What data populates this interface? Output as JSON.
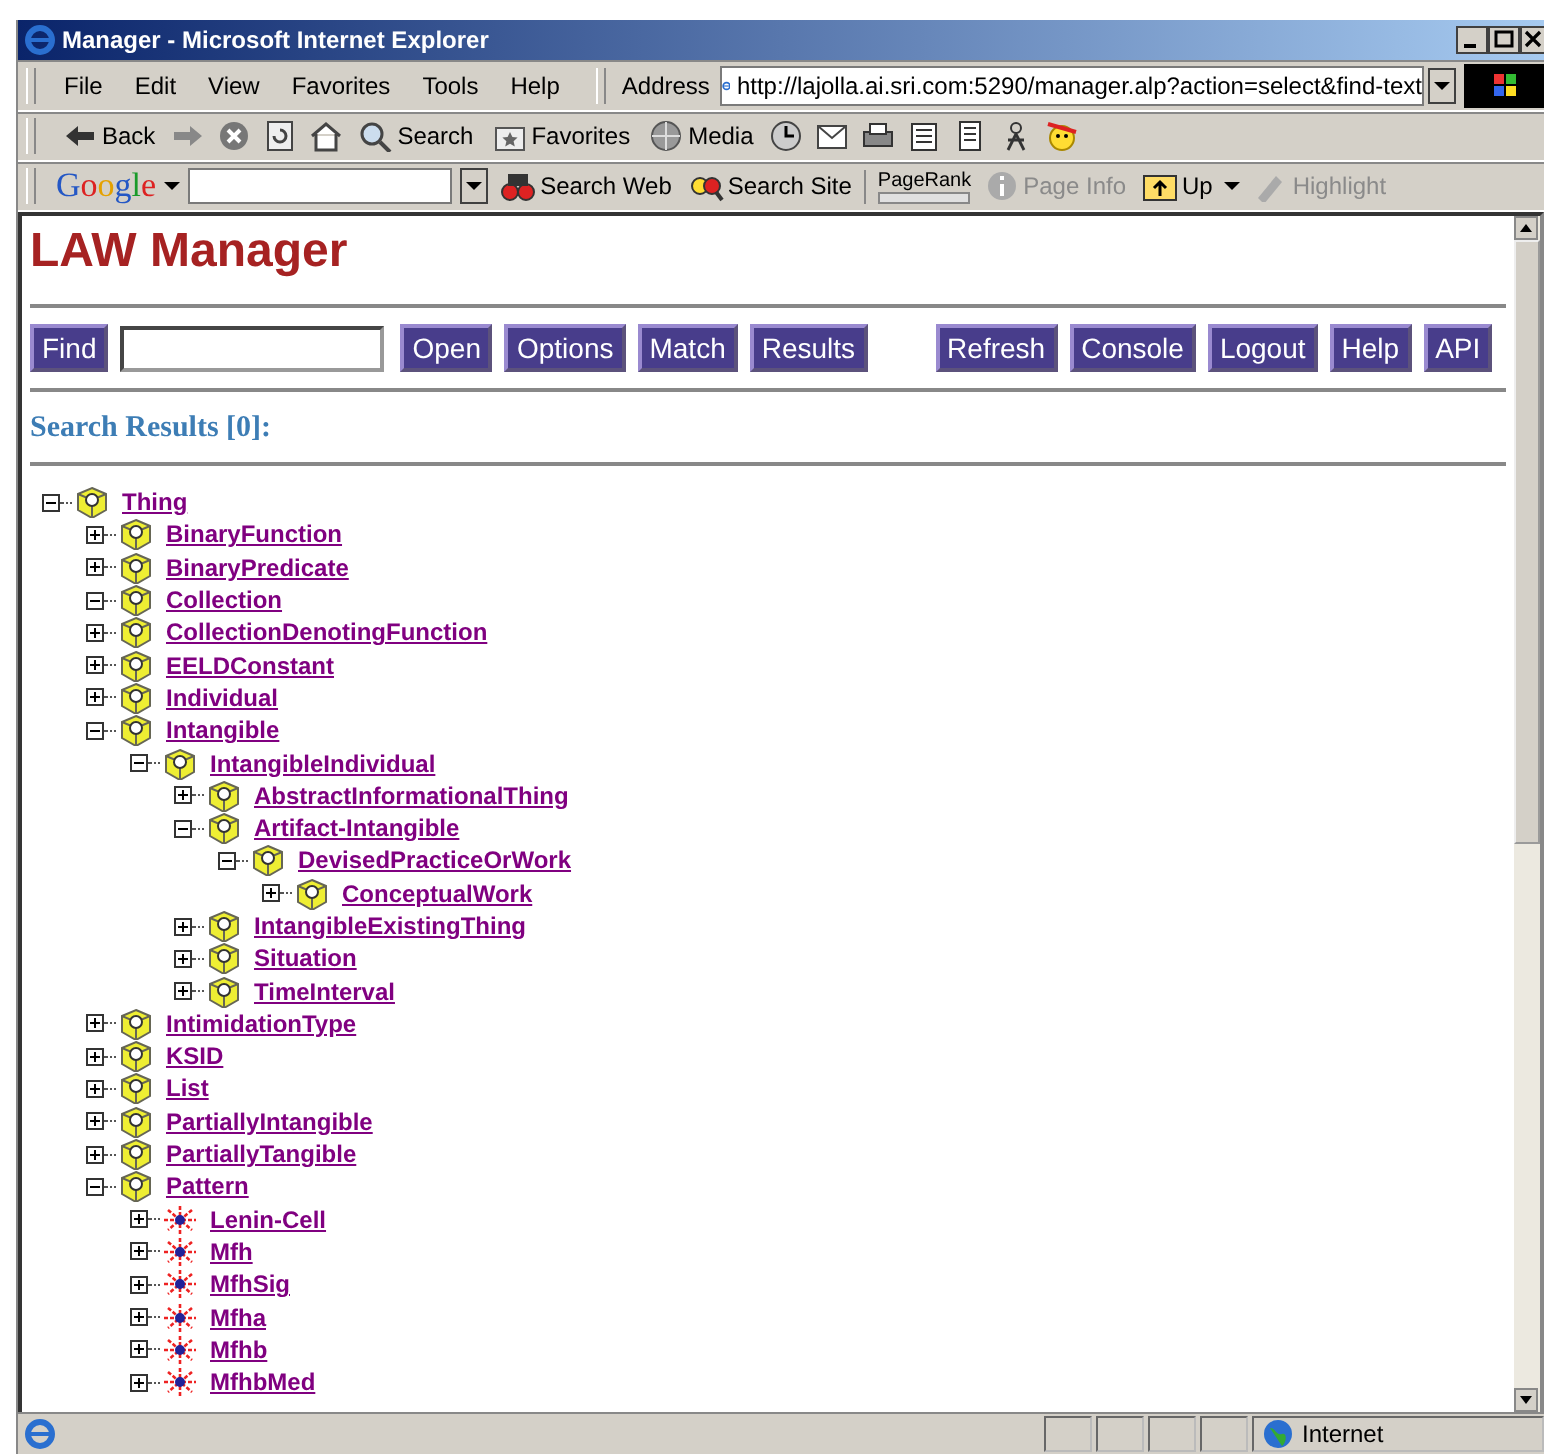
{
  "window": {
    "title": "Manager - Microsoft Internet Explorer"
  },
  "menu": [
    "File",
    "Edit",
    "View",
    "Favorites",
    "Tools",
    "Help"
  ],
  "address": {
    "label": "Address",
    "url": "http://lajolla.ai.sri.com:5290/manager.alp?action=select&find-text"
  },
  "toolbar": [
    {
      "kind": "back",
      "label": "Back"
    },
    {
      "kind": "forward"
    },
    {
      "kind": "stop"
    },
    {
      "kind": "refresh"
    },
    {
      "kind": "home"
    },
    {
      "kind": "search",
      "label": "Search"
    },
    {
      "kind": "favorites",
      "label": "Favorites"
    },
    {
      "kind": "media",
      "label": "Media"
    },
    {
      "kind": "history"
    },
    {
      "kind": "mail"
    },
    {
      "kind": "print"
    },
    {
      "kind": "edit"
    },
    {
      "kind": "discuss"
    },
    {
      "kind": "messenger"
    },
    {
      "kind": "smiley"
    }
  ],
  "google": {
    "logo": "Google",
    "search_web": "Search Web",
    "search_site": "Search Site",
    "pagerank": "PageRank",
    "page_info": "Page Info",
    "up": "Up",
    "highlight": "Highlight"
  },
  "page": {
    "heading": "LAW Manager",
    "buttons_left": [
      "Find"
    ],
    "buttons_mid": [
      "Open",
      "Options",
      "Match",
      "Results"
    ],
    "buttons_right": [
      "Refresh",
      "Console",
      "Logout",
      "Help",
      "API"
    ],
    "results_title": "Search Results [0]:"
  },
  "tree": [
    {
      "label": "Thing",
      "kind": "cube",
      "expanded": true,
      "children": [
        {
          "label": "BinaryFunction",
          "kind": "cube",
          "expanded": false
        },
        {
          "label": "BinaryPredicate",
          "kind": "cube",
          "expanded": false
        },
        {
          "label": "Collection",
          "kind": "cube",
          "expanded": true
        },
        {
          "label": "CollectionDenotingFunction",
          "kind": "cube",
          "expanded": false
        },
        {
          "label": "EELDConstant",
          "kind": "cube",
          "expanded": false
        },
        {
          "label": "Individual",
          "kind": "cube",
          "expanded": false
        },
        {
          "label": "Intangible",
          "kind": "cube",
          "expanded": true,
          "children": [
            {
              "label": "IntangibleIndividual",
              "kind": "cube",
              "expanded": true,
              "children": [
                {
                  "label": "AbstractInformationalThing",
                  "kind": "cube",
                  "expanded": false
                },
                {
                  "label": "Artifact-Intangible",
                  "kind": "cube",
                  "expanded": true,
                  "children": [
                    {
                      "label": "DevisedPracticeOrWork",
                      "kind": "cube",
                      "expanded": true,
                      "children": [
                        {
                          "label": "ConceptualWork",
                          "kind": "cube",
                          "expanded": false
                        }
                      ]
                    }
                  ]
                },
                {
                  "label": "IntangibleExistingThing",
                  "kind": "cube",
                  "expanded": false
                },
                {
                  "label": "Situation",
                  "kind": "cube",
                  "expanded": false
                },
                {
                  "label": "TimeInterval",
                  "kind": "cube",
                  "expanded": false
                }
              ]
            }
          ]
        },
        {
          "label": "IntimidationType",
          "kind": "cube",
          "expanded": false
        },
        {
          "label": "KSID",
          "kind": "cube",
          "expanded": false
        },
        {
          "label": "List",
          "kind": "cube",
          "expanded": false
        },
        {
          "label": "PartiallyIntangible",
          "kind": "cube",
          "expanded": false
        },
        {
          "label": "PartiallyTangible",
          "kind": "cube",
          "expanded": false
        },
        {
          "label": "Pattern",
          "kind": "cube",
          "expanded": true,
          "children": [
            {
              "label": "Lenin-Cell",
              "kind": "burst",
              "expanded": false
            },
            {
              "label": "Mfh",
              "kind": "burst",
              "expanded": false
            },
            {
              "label": "MfhSig",
              "kind": "burst",
              "expanded": false
            },
            {
              "label": "Mfha",
              "kind": "burst",
              "expanded": false
            },
            {
              "label": "Mfhb",
              "kind": "burst",
              "expanded": false
            },
            {
              "label": "MfhbMed",
              "kind": "burst",
              "expanded": false
            }
          ]
        }
      ]
    }
  ],
  "status_bar": {
    "zone": "Internet"
  }
}
